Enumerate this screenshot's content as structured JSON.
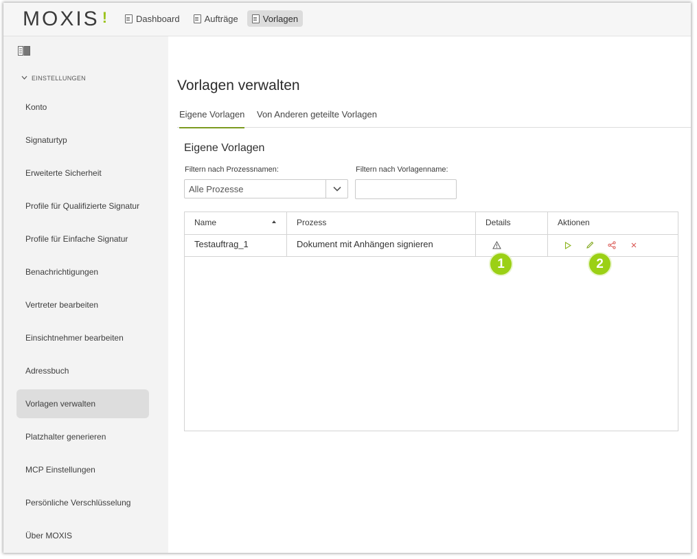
{
  "header": {
    "logo_text": "MOXIS",
    "nav": [
      {
        "label": "Dashboard",
        "icon": "document-icon"
      },
      {
        "label": "Aufträge",
        "icon": "document-icon"
      },
      {
        "label": "Vorlagen",
        "icon": "template-icon",
        "active": true
      }
    ]
  },
  "sidebar": {
    "section_label": "EINSTELLUNGEN",
    "items": [
      {
        "label": "Konto"
      },
      {
        "label": "Signaturtyp"
      },
      {
        "label": "Erweiterte Sicherheit"
      },
      {
        "label": "Profile für Qualifizierte Signatur"
      },
      {
        "label": "Profile für Einfache Signatur"
      },
      {
        "label": "Benachrichtigungen"
      },
      {
        "label": "Vertreter bearbeiten"
      },
      {
        "label": "Einsichtnehmer bearbeiten"
      },
      {
        "label": "Adressbuch"
      },
      {
        "label": "Vorlagen verwalten",
        "active": true
      },
      {
        "label": "Platzhalter generieren"
      },
      {
        "label": "MCP Einstellungen"
      },
      {
        "label": "Persönliche Verschlüsselung"
      },
      {
        "label": "Über MOXIS"
      }
    ]
  },
  "main": {
    "title": "Vorlagen verwalten",
    "tabs": [
      {
        "label": "Eigene Vorlagen",
        "active": true
      },
      {
        "label": "Von Anderen geteilte Vorlagen"
      }
    ],
    "section_title": "Eigene Vorlagen",
    "filters": {
      "process_label": "Filtern nach Prozessnamen:",
      "process_value": "Alle Prozesse",
      "template_label": "Filtern nach Vorlagenname:",
      "template_value": ""
    },
    "table": {
      "columns": [
        "Name",
        "Prozess",
        "Details",
        "Aktionen"
      ],
      "rows": [
        {
          "name": "Testauftrag_1",
          "process": "Dokument mit Anhängen signieren",
          "details_icon": "warning-icon",
          "actions": [
            "play-icon",
            "edit-icon",
            "share-icon",
            "delete-icon"
          ]
        }
      ]
    },
    "callouts": [
      "1",
      "2"
    ]
  },
  "colors": {
    "accent_green": "#9bd015",
    "tab_underline": "#7a9a1e",
    "action_play": "#8ab21a",
    "action_edit": "#7fa61a",
    "action_share": "#d9534f",
    "action_delete": "#d9534f"
  }
}
